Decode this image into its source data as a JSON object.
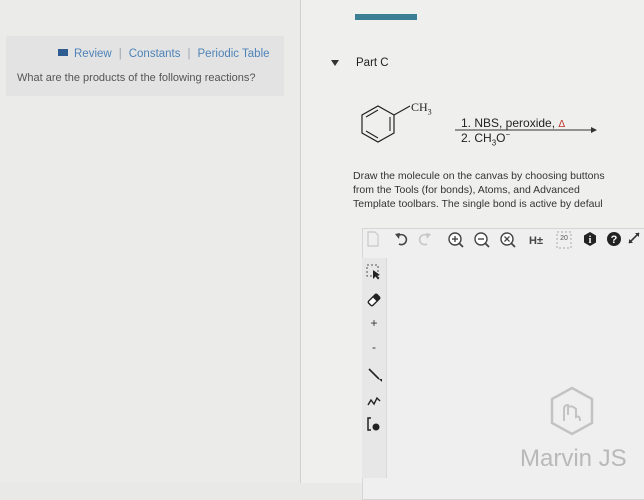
{
  "resources": {
    "review": "Review",
    "constants": "Constants",
    "periodic_table": "Periodic Table",
    "separator": "|"
  },
  "question": "What are the products of the following reactions?",
  "part": {
    "title": "Part C"
  },
  "reaction": {
    "substituent": "CH3",
    "step1": "1. NBS, peroxide,",
    "heat_symbol": "Δ",
    "step2": "2. CH3O−"
  },
  "instructions": [
    "Draw the molecule on the canvas by choosing buttons",
    "from the Tools (for bonds), Atoms, and Advanced",
    "Template toolbars. The single bond is active by defaul"
  ],
  "toolbar": {
    "explicit_h_label": "H±",
    "zoom_level": "20",
    "info_symbol": "i",
    "help_symbol": "?"
  },
  "left_tools": {
    "charge_plus": "+",
    "charge_minus": "-"
  },
  "brand": {
    "name": "Marvin JS"
  },
  "colors": {
    "link": "#4f83b8",
    "accent": "#3c7f95",
    "heat": "#c0392b"
  }
}
